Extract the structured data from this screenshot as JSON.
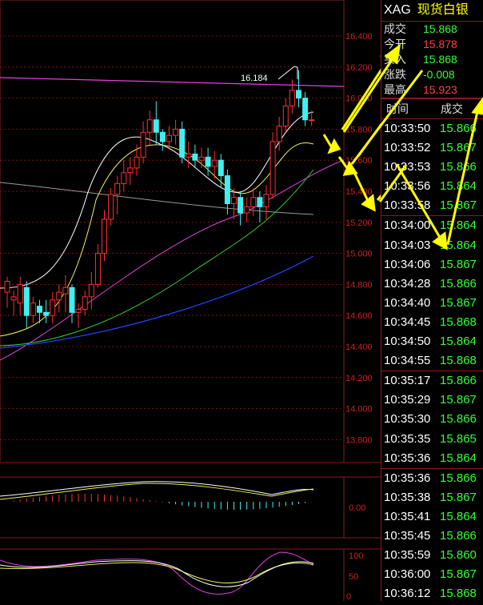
{
  "panel": {
    "symbol": "XAG",
    "name": "现货白银",
    "quote": [
      {
        "label": "成交",
        "value": "15.868",
        "color": "green"
      },
      {
        "label": "今开",
        "value": "15.878",
        "color": "red"
      },
      {
        "label": "买入",
        "value": "15.868",
        "color": "green"
      },
      {
        "label": "涨跌",
        "value": "-0.008",
        "color": "green"
      },
      {
        "label": "最高",
        "value": "15.923",
        "color": "red"
      }
    ],
    "ticks_header": {
      "time": "时间",
      "price": "成交"
    },
    "ticks": [
      {
        "time": "10:33:50",
        "price": "15.866",
        "groupend": false
      },
      {
        "time": "10:33:52",
        "price": "15.867",
        "groupend": false
      },
      {
        "time": "10:33:53",
        "price": "15.866",
        "groupend": false
      },
      {
        "time": "10:33:56",
        "price": "15.864",
        "groupend": false
      },
      {
        "time": "10:33:58",
        "price": "15.867",
        "groupend": true
      },
      {
        "time": "10:34:00",
        "price": "15.864",
        "groupend": false
      },
      {
        "time": "10:34:03",
        "price": "15.864",
        "groupend": false
      },
      {
        "time": "10:34:06",
        "price": "15.867",
        "groupend": false
      },
      {
        "time": "10:34:28",
        "price": "15.866",
        "groupend": false
      },
      {
        "time": "10:34:40",
        "price": "15.867",
        "groupend": false
      },
      {
        "time": "10:34:45",
        "price": "15.868",
        "groupend": false
      },
      {
        "time": "10:34:50",
        "price": "15.864",
        "groupend": false
      },
      {
        "time": "10:34:55",
        "price": "15.868",
        "groupend": true
      },
      {
        "time": "10:35:17",
        "price": "15.866",
        "groupend": false
      },
      {
        "time": "10:35:29",
        "price": "15.867",
        "groupend": false
      },
      {
        "time": "10:35:30",
        "price": "15.866",
        "groupend": false
      },
      {
        "time": "10:35:35",
        "price": "15.865",
        "groupend": false
      },
      {
        "time": "10:35:36",
        "price": "15.864",
        "groupend": true
      },
      {
        "time": "10:35:36",
        "price": "15.866",
        "groupend": false
      },
      {
        "time": "10:35:38",
        "price": "15.867",
        "groupend": false
      },
      {
        "time": "10:35:41",
        "price": "15.864",
        "groupend": false
      },
      {
        "time": "10:35:45",
        "price": "15.866",
        "groupend": false
      },
      {
        "time": "10:35:59",
        "price": "15.860",
        "groupend": false
      },
      {
        "time": "10:36:00",
        "price": "15.867",
        "groupend": false
      },
      {
        "time": "10:36:12",
        "price": "15.868",
        "groupend": false
      }
    ]
  },
  "main_chart": {
    "price_axis": [
      "16.400",
      "16.200",
      "16.000",
      "15.800",
      "15.600",
      "15.400",
      "15.200",
      "15.000",
      "14.800",
      "14.600",
      "14.400",
      "14.200",
      "14.000",
      "13.800"
    ],
    "high_marker": "16.184",
    "candles": [
      [
        14.75,
        14.82,
        14.65,
        14.85
      ],
      [
        14.7,
        14.72,
        14.6,
        14.76
      ],
      [
        14.68,
        14.8,
        14.6,
        14.85
      ],
      [
        14.78,
        14.6,
        14.52,
        14.82
      ],
      [
        14.6,
        14.68,
        14.55,
        14.72
      ],
      [
        14.66,
        14.62,
        14.55,
        14.7
      ],
      [
        14.62,
        14.6,
        14.55,
        14.7
      ],
      [
        14.6,
        14.7,
        14.55,
        14.75
      ],
      [
        14.7,
        14.75,
        14.62,
        14.8
      ],
      [
        14.74,
        14.78,
        14.62,
        14.86
      ],
      [
        14.78,
        14.62,
        14.55,
        14.8
      ],
      [
        14.62,
        14.64,
        14.52,
        14.68
      ],
      [
        14.64,
        14.72,
        14.6,
        14.76
      ],
      [
        14.72,
        14.8,
        14.64,
        14.88
      ],
      [
        14.8,
        15.0,
        14.78,
        15.06
      ],
      [
        15.0,
        15.22,
        14.95,
        15.28
      ],
      [
        15.22,
        15.38,
        15.18,
        15.42
      ],
      [
        15.38,
        15.45,
        15.25,
        15.5
      ],
      [
        15.45,
        15.52,
        15.4,
        15.6
      ],
      [
        15.52,
        15.55,
        15.44,
        15.62
      ],
      [
        15.55,
        15.62,
        15.5,
        15.7
      ],
      [
        15.62,
        15.78,
        15.58,
        15.85
      ],
      [
        15.78,
        15.86,
        15.7,
        15.92
      ],
      [
        15.86,
        15.78,
        15.7,
        15.98
      ],
      [
        15.78,
        15.72,
        15.66,
        15.8
      ],
      [
        15.72,
        15.76,
        15.68,
        15.82
      ],
      [
        15.76,
        15.8,
        15.7,
        15.86
      ],
      [
        15.8,
        15.62,
        15.58,
        15.85
      ],
      [
        15.62,
        15.64,
        15.55,
        15.72
      ],
      [
        15.64,
        15.6,
        15.55,
        15.7
      ],
      [
        15.6,
        15.62,
        15.55,
        15.68
      ],
      [
        15.62,
        15.56,
        15.5,
        15.68
      ],
      [
        15.56,
        15.6,
        15.48,
        15.66
      ],
      [
        15.6,
        15.5,
        15.42,
        15.64
      ],
      [
        15.5,
        15.32,
        15.25,
        15.54
      ],
      [
        15.32,
        15.36,
        15.22,
        15.42
      ],
      [
        15.36,
        15.26,
        15.18,
        15.4
      ],
      [
        15.26,
        15.3,
        15.2,
        15.36
      ],
      [
        15.3,
        15.36,
        15.24,
        15.42
      ],
      [
        15.36,
        15.3,
        15.2,
        15.4
      ],
      [
        15.3,
        15.38,
        15.22,
        15.44
      ],
      [
        15.38,
        15.72,
        15.35,
        15.78
      ],
      [
        15.72,
        15.82,
        15.66,
        15.88
      ],
      [
        15.82,
        15.95,
        15.78,
        16.0
      ],
      [
        15.95,
        16.05,
        15.9,
        16.12
      ],
      [
        16.05,
        16.0,
        15.94,
        16.18
      ],
      [
        16.0,
        15.86,
        15.82,
        16.04
      ],
      [
        15.86,
        15.86,
        15.82,
        15.92
      ]
    ]
  }
}
